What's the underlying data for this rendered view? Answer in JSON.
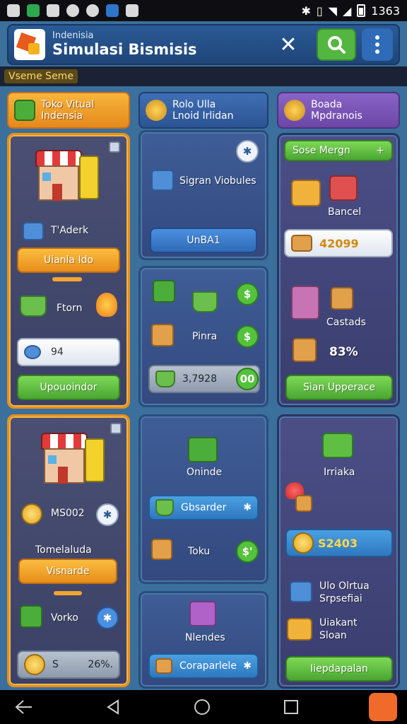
{
  "status": {
    "time": "1363"
  },
  "header": {
    "subtitle": "Indenisia",
    "title": "Simulasi Bismisis"
  },
  "subbar_label": "Vseme Seme",
  "col1": {
    "tab": {
      "line1": "Toko Vitual",
      "line2": "Indensia"
    },
    "card1": {
      "label": "T'Aderk",
      "button": "Uianla Ido",
      "cart_label": "Ftorn",
      "field_value": "94",
      "action_button": "Upouoindor"
    },
    "card2": {
      "coin_label": "MS002",
      "name_label": "Tomelaluda",
      "button": "Visnarde",
      "item_label": "Vorko",
      "field_s": "S",
      "field_value": "26%."
    }
  },
  "col2": {
    "tab": {
      "line1": "Rolo Ulla",
      "line2": "Lnoid Irlidan"
    },
    "card1": {
      "item_label": "Sigran Viobules",
      "button": "UnBA1"
    },
    "card2": {
      "label": "Pinra",
      "field_value": "3,7928",
      "badge": "00",
      "circle1": "$",
      "circle2": "$"
    },
    "card3": {
      "label": "Oninde",
      "button": "Gbsarder",
      "shop_label": "Toku",
      "circle": "$'"
    },
    "card4": {
      "label": "Nlendes",
      "button": "Coraparlele"
    }
  },
  "col3": {
    "tab": {
      "line1": "Boada",
      "line2": "Mpdranois"
    },
    "card1": {
      "top_button": "Sose Mergn",
      "label": "Bancel",
      "price": "42099",
      "storage_label": "Castads",
      "percent": "83%",
      "action_button": "Sian Upperace"
    },
    "card2": {
      "label1": "Irriaka",
      "price": "S2403",
      "label2_line1": "Ulo Olrtua",
      "label2_line2": "Srpsefiai",
      "label3_line1": "Uiakant",
      "label3_line2": "Sloan",
      "button": "Iiepdapalan"
    }
  }
}
